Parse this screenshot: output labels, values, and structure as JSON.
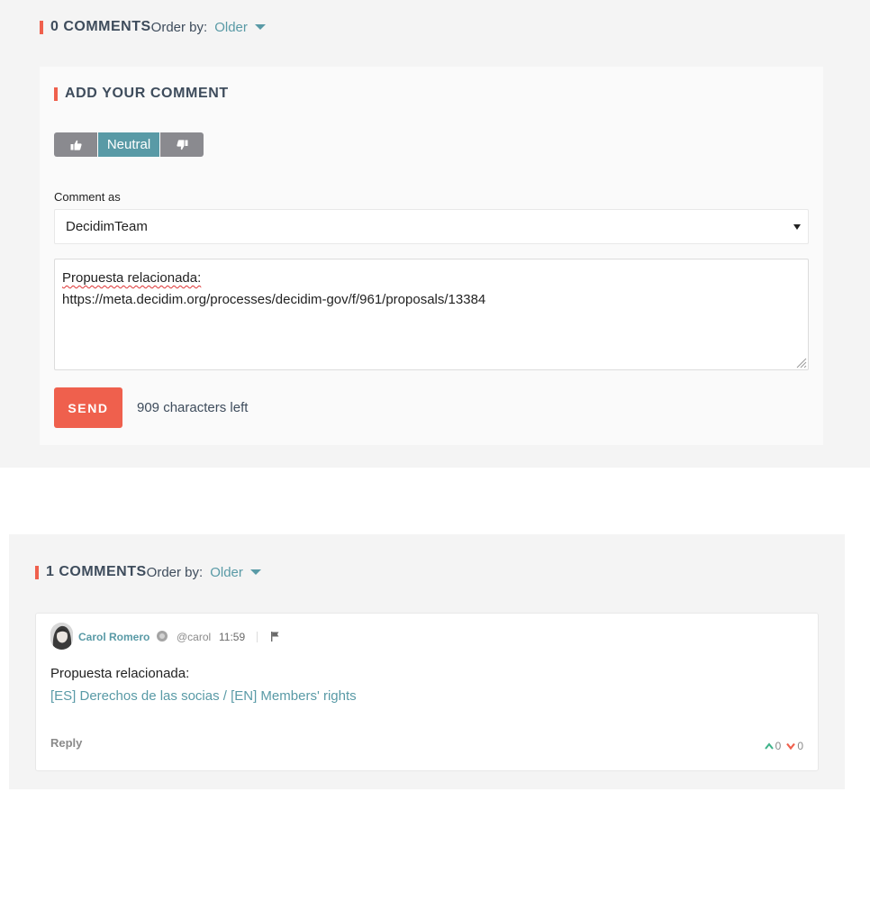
{
  "top_section": {
    "count_label": "0 COMMENTS",
    "order_label": "Order by:",
    "order_value": "Older"
  },
  "add_comment": {
    "title": "ADD YOUR COMMENT",
    "alignment": {
      "up_icon": "thumbs-up-icon",
      "neutral_label": "Neutral",
      "down_icon": "thumbs-down-icon",
      "selected": "neutral"
    },
    "comment_as_label": "Comment as",
    "comment_as_value": "DecidimTeam",
    "textarea_line1": "Propuesta relacionada:",
    "textarea_line2": "https://meta.decidim.org/processes/decidim-gov/f/961/proposals/13384",
    "send_label": "SEND",
    "chars_left": "909 characters left"
  },
  "bottom_section": {
    "count_label": "1 COMMENTS",
    "order_label": "Order by:",
    "order_value": "Older"
  },
  "comment": {
    "author_name": "Carol Romero",
    "nickname": "@carol",
    "time": "11:59",
    "body_line1": "Propuesta relacionada:",
    "body_link": "[ES] Derechos de las socias / [EN] Members' rights",
    "reply_label": "Reply",
    "upvotes": "0",
    "downvotes": "0"
  },
  "colors": {
    "accent": "#ef604d",
    "link": "#599aa6",
    "muted": "#8a8a8f",
    "panel_bg": "#f4f4f4"
  }
}
